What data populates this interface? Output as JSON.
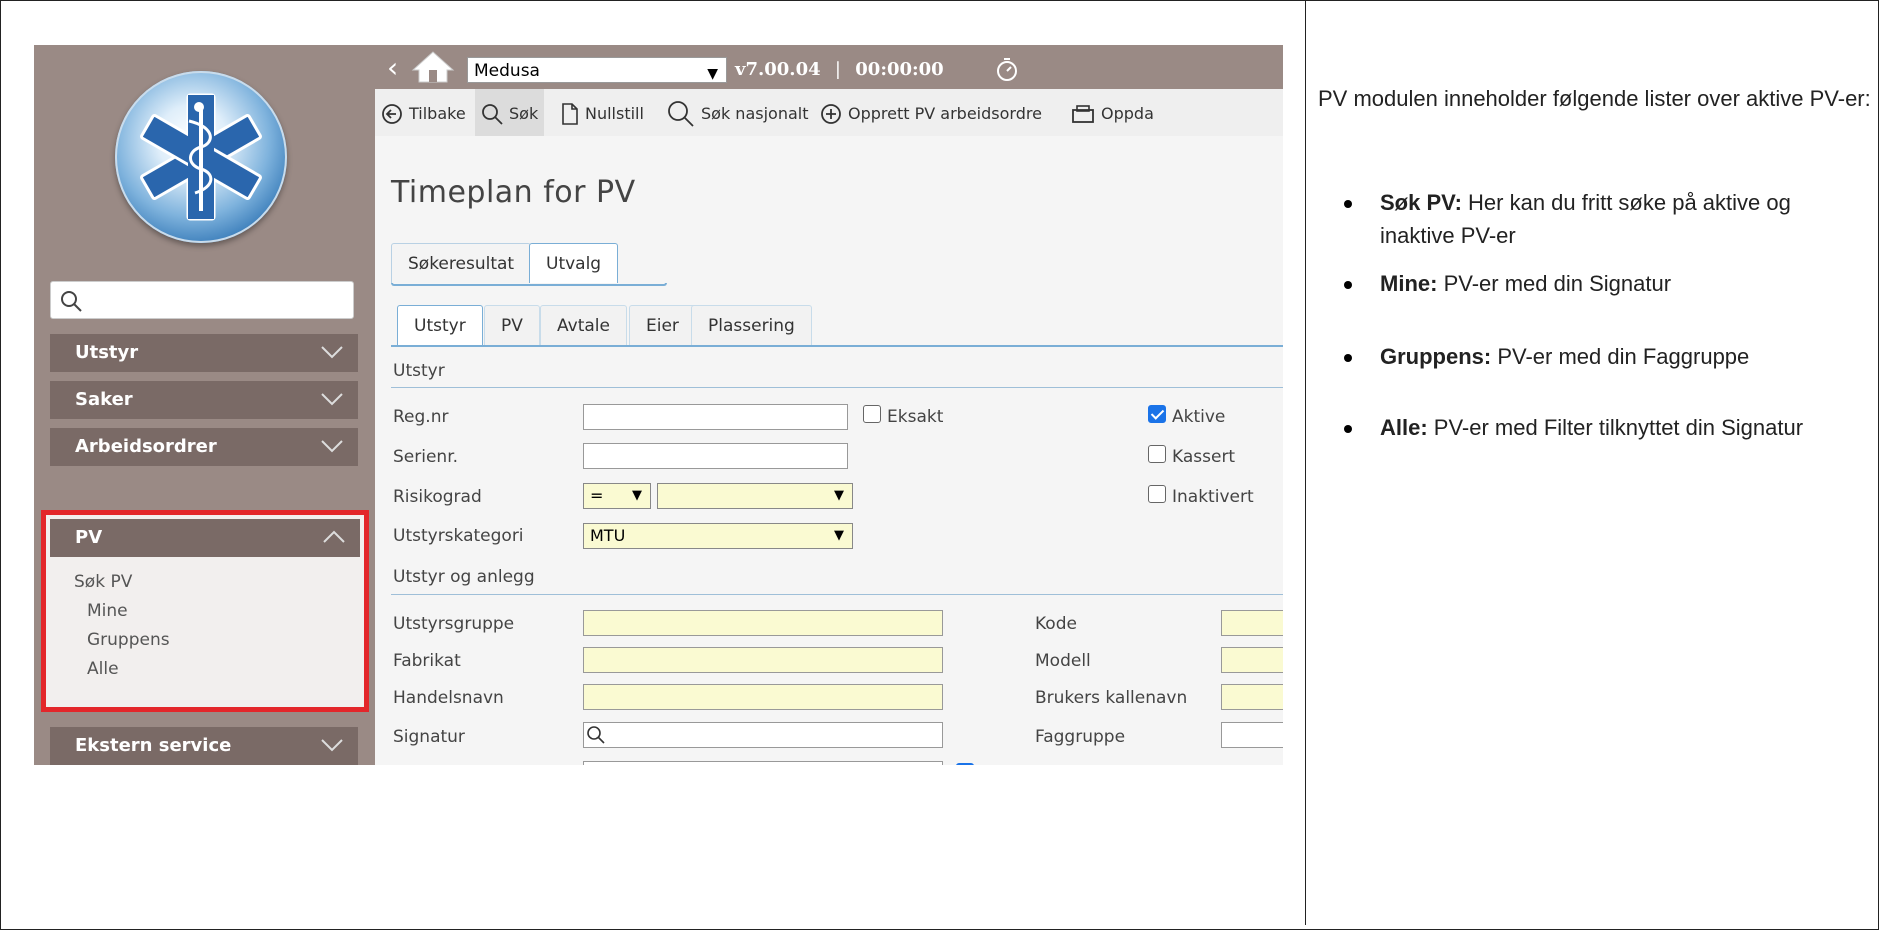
{
  "sidebar": {
    "search_placeholder": "",
    "items": [
      {
        "label": "Utstyr"
      },
      {
        "label": "Saker"
      },
      {
        "label": "Arbeidsordrer"
      },
      {
        "label": "PV"
      },
      {
        "label": "Ekstern service"
      }
    ],
    "pv_sub": [
      "Søk PV",
      "Mine",
      "Gruppens",
      "Alle"
    ]
  },
  "topbar": {
    "system": "Medusa",
    "version": "v7.00.04",
    "separator": "|",
    "timer": "00:00:00"
  },
  "toolbar": [
    "Tilbake",
    "Søk",
    "Nullstill",
    "Søk nasjonalt",
    "Opprett PV arbeidsordre",
    "Oppda"
  ],
  "page_title": "Timeplan for PV",
  "tabs_top": [
    "Søkeresultat",
    "Utvalg"
  ],
  "tabs_sub": [
    "Utstyr",
    "PV",
    "Avtale",
    "Eier",
    "Plassering"
  ],
  "form": {
    "section1": "Utstyr",
    "reg_nr": "Reg.nr",
    "eksakt": "Eksakt",
    "aktive": "Aktive",
    "serienr": "Serienr.",
    "kassert": "Kassert",
    "risikograd": "Risikograd",
    "risiko_op": "=",
    "inaktivert": "Inaktivert",
    "utstyrskategori": "Utstyrskategori",
    "utstyrskategori_value": "MTU",
    "section2": "Utstyr og anlegg",
    "utstyrsgruppe": "Utstyrsgruppe",
    "kode": "Kode",
    "fabrikat": "Fabrikat",
    "modell": "Modell",
    "handelsnavn": "Handelsnavn",
    "brukers_kallenavn": "Brukers kallenavn",
    "signatur": "Signatur",
    "faggruppe": "Faggruppe",
    "aktive_checked": true
  },
  "right": {
    "intro": "PV modulen inneholder følgende lister over aktive PV-er:",
    "bullets": [
      {
        "term": "Søk PV:",
        "text": " Her kan du fritt søke på aktive og inaktive PV-er"
      },
      {
        "term": "Mine:",
        "text": " PV-er med din Signatur"
      },
      {
        "term": "Gruppens:",
        "text": " PV-er med din Faggruppe"
      },
      {
        "term": "Alle:",
        "text": " PV-er med Filter tilknyttet din Signatur"
      }
    ]
  }
}
